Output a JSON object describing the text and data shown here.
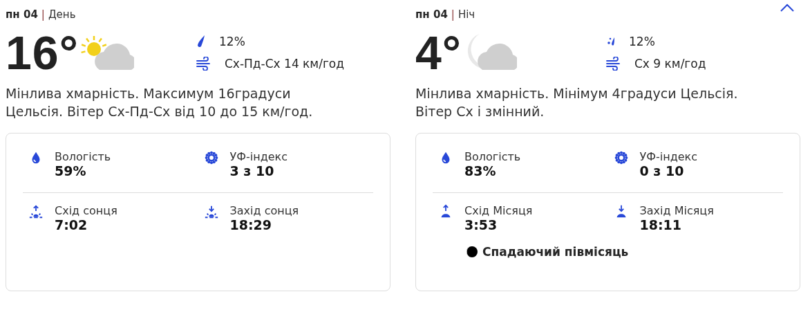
{
  "panels": [
    {
      "day": "пн 04",
      "separator": "|",
      "period": "День",
      "temperature": "16°",
      "condition": {
        "kind": "partly-sunny"
      },
      "precip": {
        "kind": "drop"
      },
      "precipitation": "12%",
      "wind": "Сх-Пд-Сх 14 км/год",
      "description": "Мінлива хмарність. Максимум 16градуси Цельсія. Вітер Сх-Пд-Сх від 10 до 15 км/год.",
      "details": [
        [
          {
            "kind": "humidity",
            "label": "Вологість",
            "value": "59%"
          },
          {
            "kind": "uv",
            "label": "УФ-індекс",
            "value": "3 з 10"
          }
        ],
        [
          {
            "kind": "sunrise",
            "label": "Схід сонця",
            "value": "7:02"
          },
          {
            "kind": "sunset",
            "label": "Захід сонця",
            "value": "18:29"
          }
        ]
      ]
    },
    {
      "day": "пн 04",
      "separator": "|",
      "period": "Ніч",
      "temperature": "4°",
      "condition": {
        "kind": "partly-cloudy-night"
      },
      "precip": {
        "kind": "showers"
      },
      "precipitation": "12%",
      "wind": "Сх 9 км/год",
      "description": "Мінлива хмарність. Мінімум 4градуси Цельсія. Вітер Сх і змінний.",
      "details": [
        [
          {
            "kind": "humidity",
            "label": "Вологість",
            "value": "83%"
          },
          {
            "kind": "uv",
            "label": "УФ-індекс",
            "value": "0 з 10"
          }
        ],
        [
          {
            "kind": "moonrise",
            "label": "Схід Місяця",
            "value": "3:53"
          },
          {
            "kind": "moonset",
            "label": "Захід Місяця",
            "value": "18:11"
          }
        ]
      ],
      "moon_phase": "Спадаючий півмісяць",
      "collapse_button": true
    }
  ]
}
